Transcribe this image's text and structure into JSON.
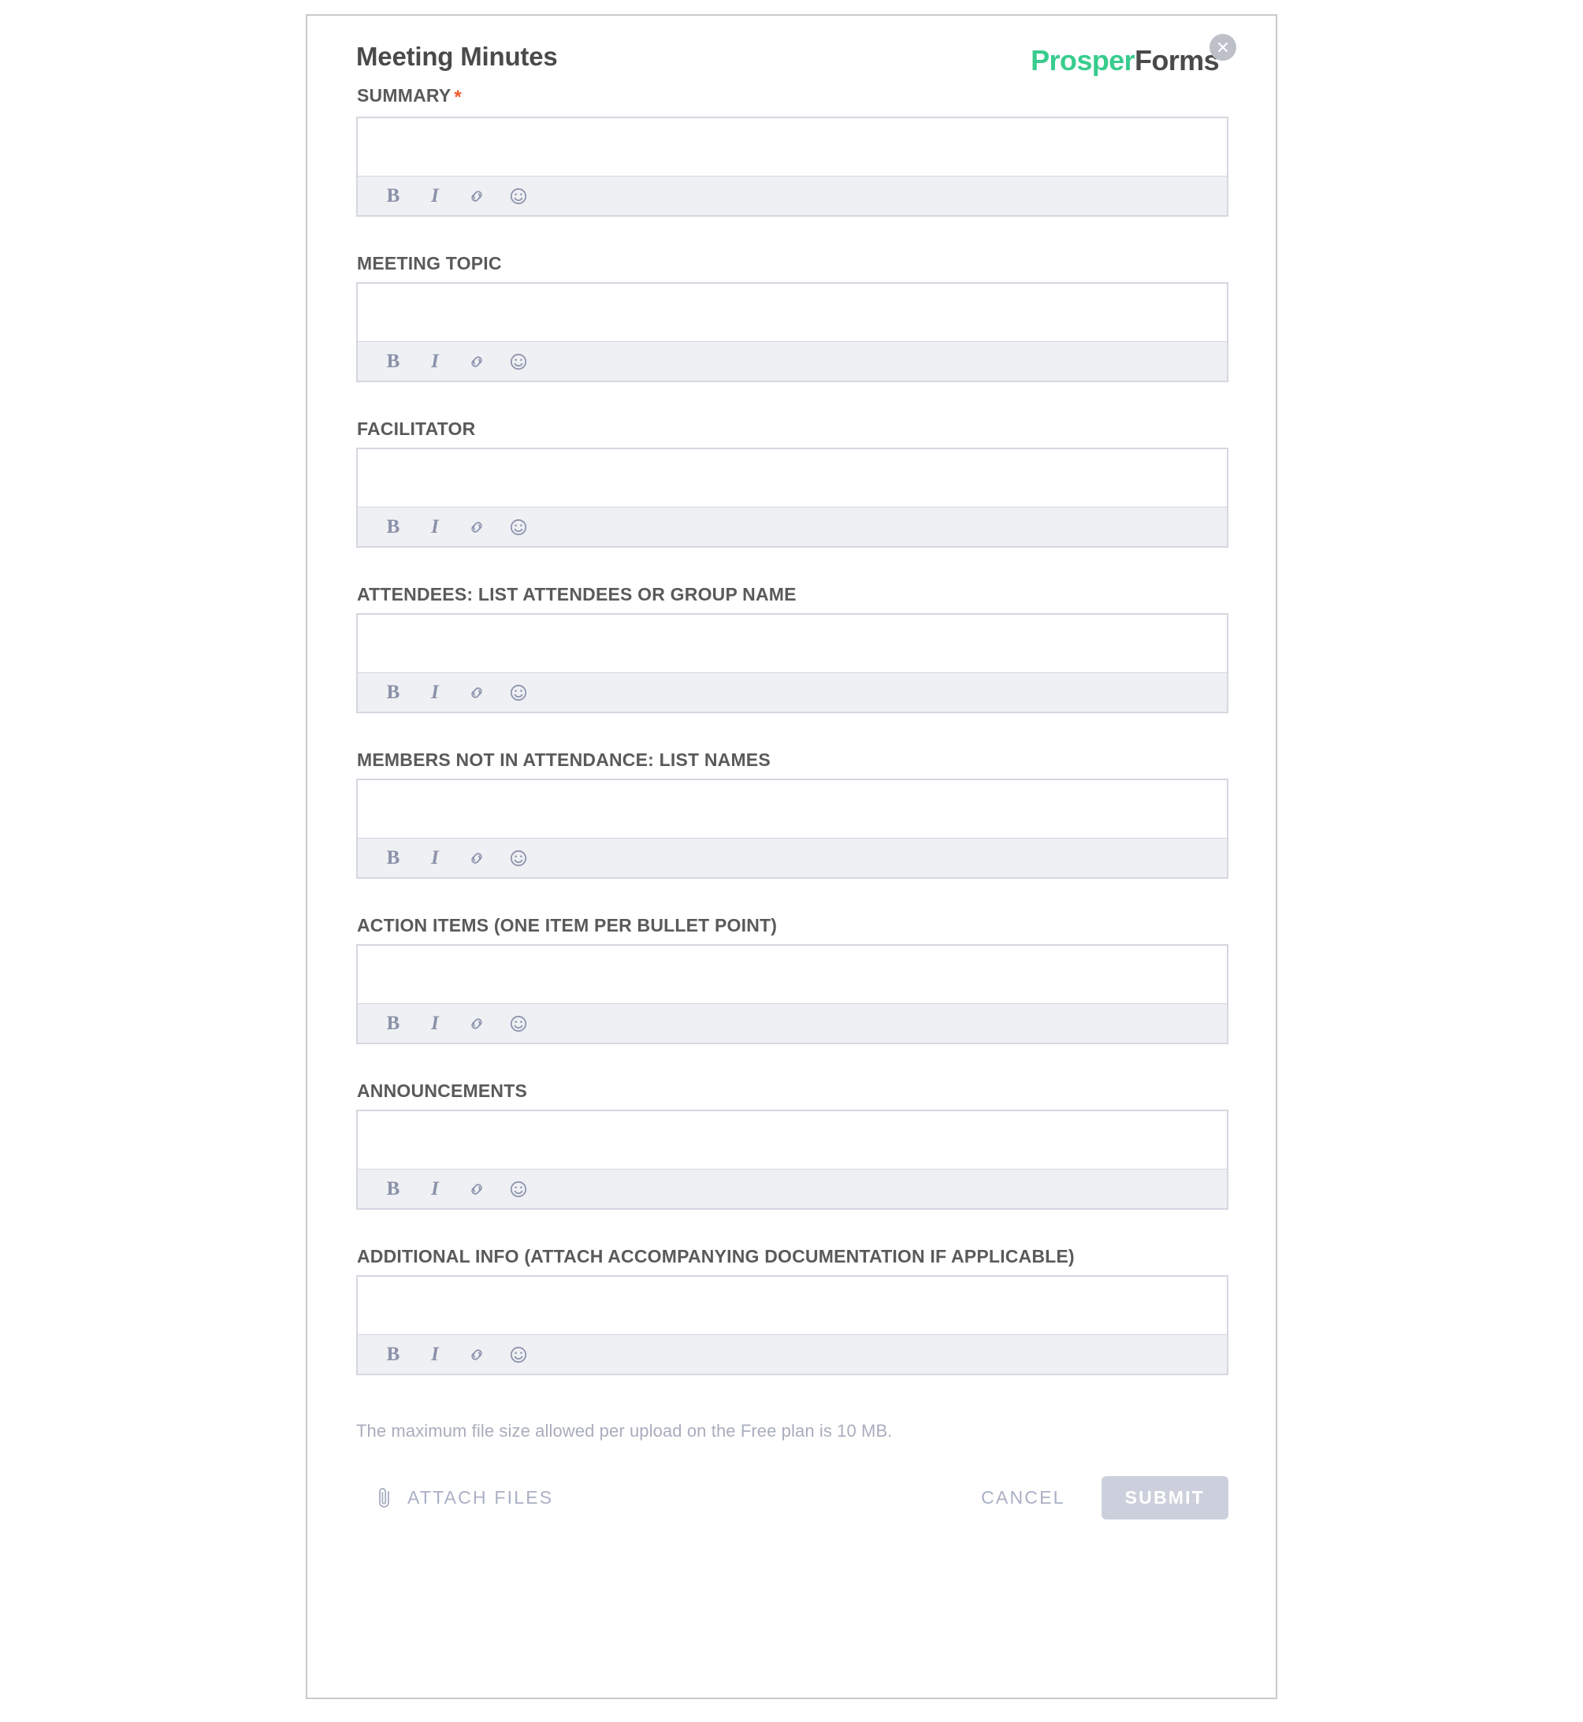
{
  "header": {
    "title": "Meeting Minutes",
    "brand_first": "Prosper",
    "brand_second": "Forms",
    "brand_color": "#38cc8e",
    "close_icon": "close-icon"
  },
  "fields": [
    {
      "label": "SUMMARY",
      "required": true,
      "required_marker": "*",
      "value": "",
      "placeholder": ""
    },
    {
      "label": "MEETING TOPIC",
      "required": false,
      "required_marker": "",
      "value": "",
      "placeholder": ""
    },
    {
      "label": "FACILITATOR",
      "required": false,
      "required_marker": "",
      "value": "",
      "placeholder": ""
    },
    {
      "label": "ATTENDEES: LIST ATTENDEES OR GROUP NAME",
      "required": false,
      "required_marker": "",
      "value": "",
      "placeholder": ""
    },
    {
      "label": "MEMBERS NOT IN ATTENDANCE: LIST NAMES",
      "required": false,
      "required_marker": "",
      "value": "",
      "placeholder": ""
    },
    {
      "label": "ACTION ITEMS (ONE ITEM PER BULLET POINT)",
      "required": false,
      "required_marker": "",
      "value": "",
      "placeholder": ""
    },
    {
      "label": "ANNOUNCEMENTS",
      "required": false,
      "required_marker": "",
      "value": "",
      "placeholder": ""
    },
    {
      "label": "ADDITIONAL INFO (ATTACH ACCOMPANYING DOCUMENTATION IF APPLICABLE)",
      "required": false,
      "required_marker": "",
      "value": "",
      "placeholder": ""
    }
  ],
  "toolbar": {
    "bold_label": "B",
    "italic_label": "I",
    "icons": [
      "bold-icon",
      "italic-icon",
      "link-icon",
      "emoji-icon"
    ]
  },
  "footer": {
    "file_size_note": "The maximum file size allowed per upload on the Free plan is 10 MB.",
    "attach_label": "ATTACH FILES",
    "attach_icon": "paperclip-icon",
    "cancel_label": "CANCEL",
    "submit_label": "SUBMIT",
    "submit_disabled_color": "#ccd0dc"
  }
}
